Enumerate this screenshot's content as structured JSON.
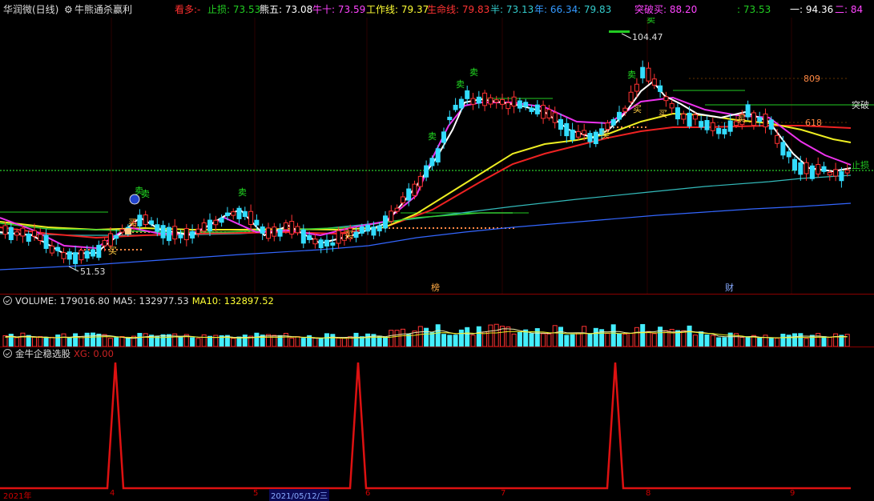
{
  "header": {
    "stock_name": "华润微(日线)",
    "indicator_name": "牛熊通杀赢利",
    "items": [
      {
        "label": "看多:-",
        "color": "#ff3030"
      },
      {
        "label": "止损: 73.53",
        "color": "#22cc22"
      },
      {
        "label": "熊五: 73.08",
        "color": "#ffffff"
      },
      {
        "label": "牛十: 73.59",
        "color": "#ff44ff"
      },
      {
        "label": "工作线: 79.37",
        "color": "#ffff33"
      },
      {
        "label": "生命线: 79.83",
        "color": "#ff3333"
      },
      {
        "label": "半: 73.13",
        "color": "#33cccc"
      },
      {
        "label": "年: 66.34",
        "color": "#3399ff"
      },
      {
        "label": ": 79.83",
        "color": "#33cccc"
      },
      {
        "label": "突破买: 88.20",
        "color": "#ff44ff"
      },
      {
        "label": ": 73.53",
        "color": "#22cc22"
      },
      {
        "label": "一: 94.36",
        "color": "#ffffff"
      },
      {
        "label": "二: 84",
        "color": "#ff44ff"
      }
    ]
  },
  "main_chart": {
    "high_label": "104.47",
    "low_label": "51.53",
    "level_809": "809",
    "level_618": "618",
    "break_label": "突破",
    "stop_label": "止损",
    "marker_bang": "榜",
    "marker_cai": "财",
    "sell_label": "卖",
    "buy_label": "买"
  },
  "volume_panel": {
    "label": "VOLUME: 179016.80",
    "ma5": "MA5: 132977.53",
    "ma10": "MA10: 132897.52",
    "colors": {
      "label": "#dddddd",
      "ma5": "#dddddd",
      "ma10": "#ffff33"
    }
  },
  "signal_panel": {
    "label": "金牛企稳选股",
    "xg": "XG: 0.00",
    "colors": {
      "label": "#dddddd",
      "xg": "#cc2222"
    }
  },
  "date_axis": {
    "year": "2021年",
    "ticks": [
      "4",
      "5",
      "2021/05/12/三",
      "6",
      "7",
      "8",
      "9"
    ]
  },
  "chart_data": {
    "type": "candlestick",
    "signal_spikes_at": [
      0.132,
      0.41,
      0.702
    ],
    "ylim": [
      51.53,
      104.47
    ]
  }
}
